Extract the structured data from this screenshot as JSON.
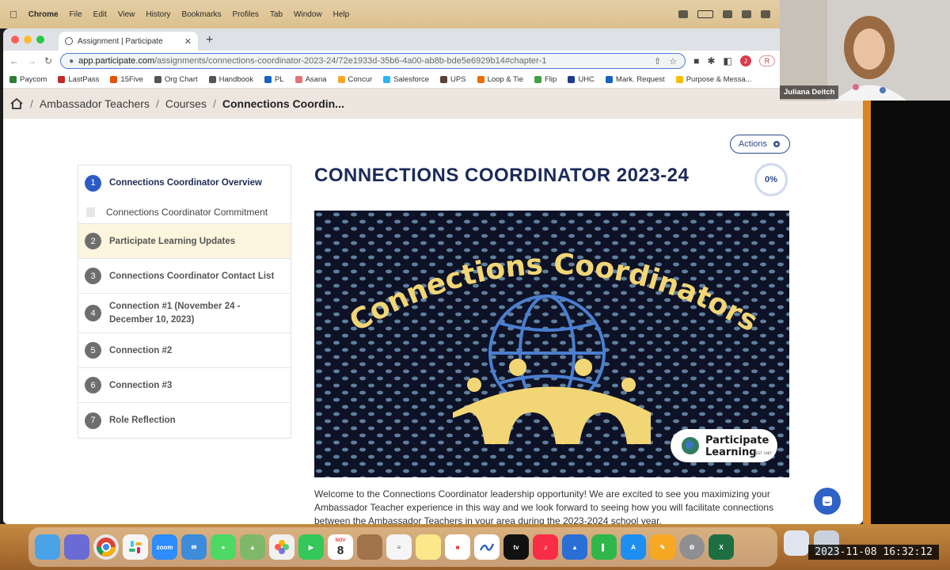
{
  "menubar": {
    "app": "Chrome",
    "items": [
      "File",
      "Edit",
      "View",
      "History",
      "Bookmarks",
      "Profiles",
      "Tab",
      "Window",
      "Help"
    ]
  },
  "browser": {
    "tab_title": "Assignment | Participate",
    "url_host": "app.participate.com",
    "url_path": "/assignments/connections-coordinator-2023-24/72e1933d-35b6-4a00-ab8b-bde5e6929b14#chapter-1",
    "profile_initial": "J",
    "relaunch_label": "R",
    "bookmarks": [
      {
        "label": "Paycom",
        "color": "#2e7d32"
      },
      {
        "label": "LastPass",
        "color": "#c62828"
      },
      {
        "label": "15Five",
        "color": "#e65100"
      },
      {
        "label": "Org Chart",
        "color": "#555555"
      },
      {
        "label": "Handbook",
        "color": "#555555"
      },
      {
        "label": "PL",
        "color": "#1565c0"
      },
      {
        "label": "Asana",
        "color": "#e57373"
      },
      {
        "label": "Concur",
        "color": "#f9a825"
      },
      {
        "label": "Salesforce",
        "color": "#29b6f6"
      },
      {
        "label": "UPS",
        "color": "#5d4037"
      },
      {
        "label": "Loop & Tie",
        "color": "#ef6c00"
      },
      {
        "label": "Flip",
        "color": "#43a047"
      },
      {
        "label": "UHC",
        "color": "#1e3a8a"
      },
      {
        "label": "Mark. Request",
        "color": "#1565c0"
      },
      {
        "label": "Purpose & Messa...",
        "color": "#fbbc04"
      }
    ]
  },
  "breadcrumb": {
    "items": [
      "Ambassador Teachers",
      "Courses"
    ],
    "current": "Connections Coordin..."
  },
  "actions_label": "Actions",
  "sidebar": {
    "chapters": [
      {
        "num": "1",
        "label": "Connections Coordinator Overview",
        "sub": "Connections Coordinator Commitment"
      },
      {
        "num": "2",
        "label": "Participate Learning Updates"
      },
      {
        "num": "3",
        "label": "Connections Coordinator Contact List"
      },
      {
        "num": "4",
        "label": "Connection #1 (November 24 - December 10, 2023)"
      },
      {
        "num": "5",
        "label": "Connection #2"
      },
      {
        "num": "6",
        "label": "Connection #3"
      },
      {
        "num": "7",
        "label": "Role Reflection"
      }
    ]
  },
  "main": {
    "title": "CONNECTIONS COORDINATOR 2023-24",
    "progress": "0%",
    "hero_heading": "Connections Coordinators",
    "hero_logo_line1": "Participate",
    "hero_logo_line2": "Learning",
    "hero_logo_est": "EST. 1987",
    "intro": "Welcome to the Connections Coordinator leadership opportunity! We are excited to see you maximizing your Ambassador Teacher experience in this way and we look forward to seeing how you will facilitate connections between the Ambassador Teachers in your area during the 2023-2024 school year."
  },
  "webcam": {
    "name": "Juliana Deitch"
  },
  "dock": {
    "calendar_month": "NOV",
    "calendar_day": "8",
    "zoom_label": "zoom",
    "tv_label": "tv"
  },
  "timestamp": "2023-11-08 16:32:12",
  "colors": {
    "accent": "#2d5bc6",
    "title": "#1c2a5a",
    "highlight": "#fdf5dd",
    "hero_yellow": "#f2d675",
    "globe_blue": "#4a7fd0"
  }
}
